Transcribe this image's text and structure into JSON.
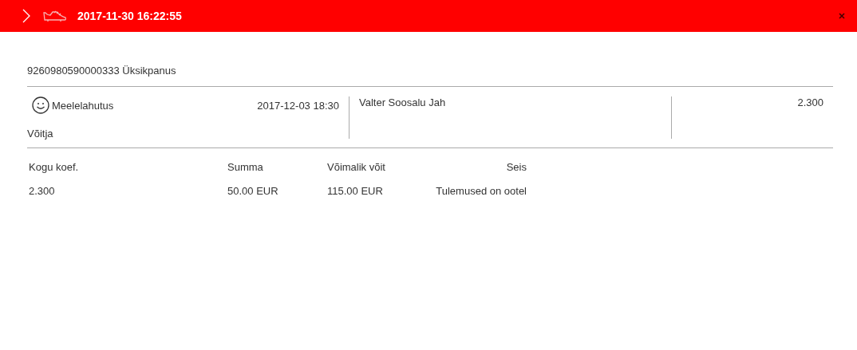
{
  "header": {
    "timestamp": "2017-11-30 16:22:55"
  },
  "ticket": {
    "title": "9260980590000333 Üksikpanus"
  },
  "selection": {
    "category": "Meelelahutus",
    "date": "2017-12-03 18:30",
    "market": "Võitja",
    "pick": "Valter Soosalu Jah",
    "odds": "2.300"
  },
  "summary": {
    "columns": [
      "Kogu koef.",
      "Summa",
      "Võimalik võit",
      "Seis"
    ],
    "values": [
      "2.300",
      "50.00 EUR",
      "115.00 EUR",
      "Tulemused on ootel"
    ]
  }
}
